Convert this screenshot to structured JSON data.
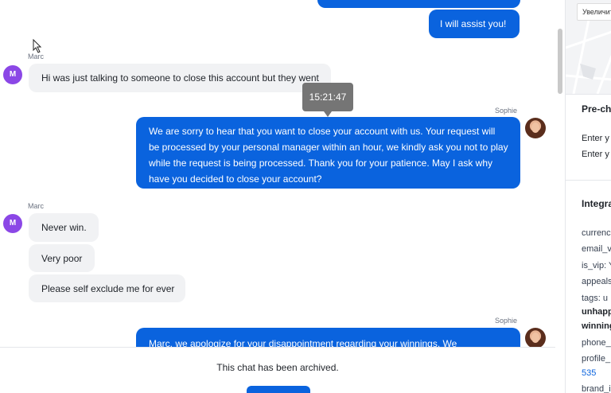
{
  "messages": {
    "top_out_cut": "",
    "assist": "I will assist you!",
    "marc_label_1": "Marc",
    "avatar_letter": "M",
    "marc_msg_1": "Hi was just talking to someone to close this account but they went",
    "tooltip_time": "15:21:47",
    "sophie_label_1": "Sophie",
    "sophie_msg_1_l1": "We are sorry to hear that you want to close your account with us. Your request will",
    "sophie_msg_1_l2": "be processed by your personal manager within an hour, we kindly ask you not to play",
    "sophie_msg_1_l3": "while the request is being processed. Thank you for your patience. May I ask why",
    "sophie_msg_1_l4": "have you decided to close your account?",
    "marc_label_2": "Marc",
    "marc_msg_2": "Never win.",
    "marc_msg_3": "Very poor",
    "marc_msg_4": "Please self exclude me for ever",
    "sophie_label_2": "Sophie",
    "sophie_msg_2": "Marc, we apologize for your disappointment regarding your winnings. We"
  },
  "archived": {
    "text": "This chat has been archived."
  },
  "panel": {
    "map_label": "Увеличить",
    "prechat_heading": "Pre-ch",
    "enter_1": "Enter y",
    "enter_2": "Enter y",
    "integrations_heading": "Integra",
    "field_currency": "currenc",
    "field_email": "email_v",
    "field_isvip": "is_vip: Y",
    "field_appeals": "appeals",
    "field_tags": "tags: u",
    "field_tags_2": "unhapp",
    "field_tags_3": "winning",
    "field_phone": "phone_",
    "field_profile": "profile_",
    "field_profile_val": "535",
    "field_brand": "brand_i"
  },
  "colors": {
    "accent": "#0a63de",
    "avatar_marc": "#8b47e6",
    "incoming_bg": "#f1f2f4",
    "tooltip_bg": "#757575"
  }
}
